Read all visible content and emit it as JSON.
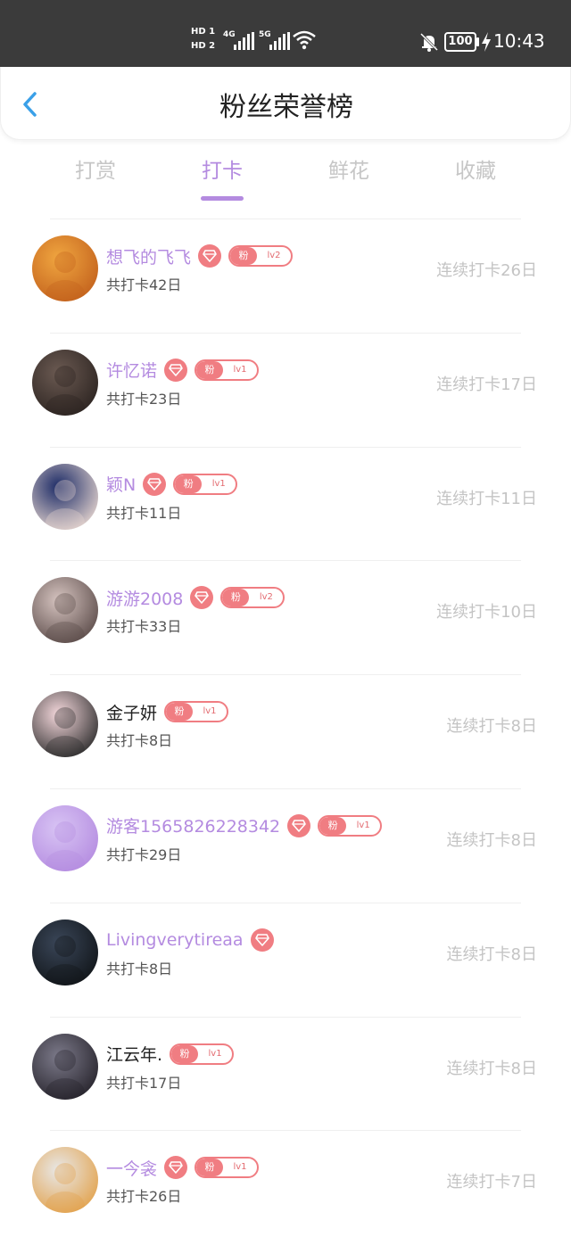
{
  "status_bar": {
    "hd1": "HD 1",
    "hd2": "HD 2",
    "net1": "4G",
    "net2": "5G",
    "battery": "100",
    "time": "10:43",
    "icons": [
      "signal-icon",
      "wifi-icon",
      "bell-muted-icon",
      "battery-icon",
      "charging-icon"
    ]
  },
  "header": {
    "title": "粉丝荣誉榜",
    "back_icon": "back-arrow-icon"
  },
  "tabs": [
    {
      "label": "打赏",
      "active": false
    },
    {
      "label": "打卡",
      "active": true
    },
    {
      "label": "鲜花",
      "active": false
    },
    {
      "label": "收藏",
      "active": false
    }
  ],
  "colors": {
    "accent": "#b48be0",
    "badge": "#f07d82",
    "muted": "#c4c4c4",
    "status_bar": "#3b3b3b"
  },
  "fan_badge_label": "粉",
  "rows": [
    {
      "name": "想飞的飞飞",
      "total": "共打卡42日",
      "streak": "连续打卡26日",
      "vip": true,
      "level": "lv2",
      "plain": false,
      "avatar_colors": [
        "#f0a640",
        "#c2601c"
      ]
    },
    {
      "name": "许忆诺",
      "total": "共打卡23日",
      "streak": "连续打卡17日",
      "vip": true,
      "level": "lv1",
      "plain": false,
      "avatar_colors": [
        "#6b5a52",
        "#2b2320"
      ]
    },
    {
      "name": "颖N",
      "total": "共打卡11日",
      "streak": "连续打卡11日",
      "vip": true,
      "level": "lv1",
      "plain": false,
      "avatar_colors": [
        "#1b2a66",
        "#e8d7d0"
      ]
    },
    {
      "name": "游游2008",
      "total": "共打卡33日",
      "streak": "连续打卡10日",
      "vip": true,
      "level": "lv2",
      "plain": false,
      "avatar_colors": [
        "#d6c4c0",
        "#5a4a48"
      ]
    },
    {
      "name": "金子妍",
      "total": "共打卡8日",
      "streak": "连续打卡8日",
      "vip": false,
      "level": "lv1",
      "plain": true,
      "avatar_colors": [
        "#f5d8dc",
        "#2a2a2a"
      ]
    },
    {
      "name": "游客1565826228342",
      "total": "共打卡29日",
      "streak": "连续打卡8日",
      "vip": true,
      "level": "lv1",
      "plain": false,
      "avatar_colors": [
        "#d8c4f4",
        "#b48be0"
      ]
    },
    {
      "name": "Livingverytireaa",
      "total": "共打卡8日",
      "streak": "连续打卡8日",
      "vip": true,
      "level": null,
      "plain": false,
      "avatar_colors": [
        "#3a4658",
        "#101418"
      ]
    },
    {
      "name": "江云年.",
      "total": "共打卡17日",
      "streak": "连续打卡8日",
      "vip": false,
      "level": "lv1",
      "plain": true,
      "avatar_colors": [
        "#7c7a8a",
        "#25222a"
      ]
    },
    {
      "name": "一今衾",
      "total": "共打卡26日",
      "streak": "连续打卡7日",
      "vip": true,
      "level": "lv1",
      "plain": false,
      "avatar_colors": [
        "#e8e8e8",
        "#e2a14a"
      ]
    }
  ]
}
